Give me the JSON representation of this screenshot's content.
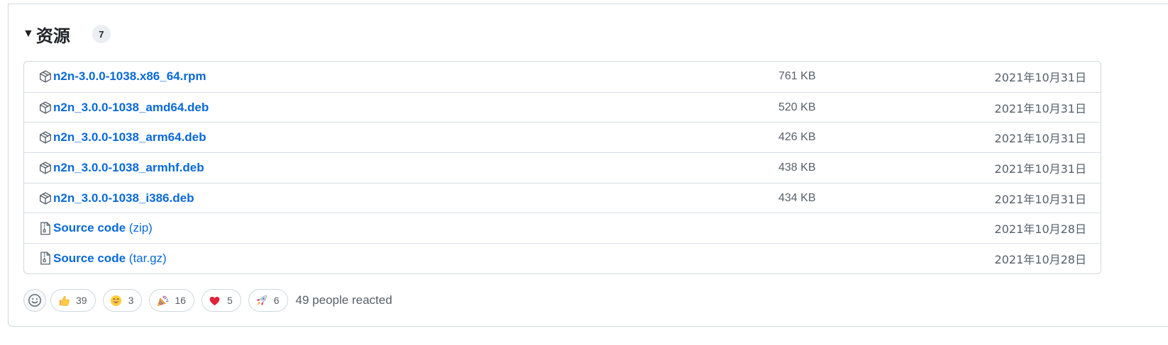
{
  "assets": {
    "title": "资源",
    "count": "7",
    "items": [
      {
        "name": "n2n-3.0.0-1038.x86_64.rpm",
        "suffix": "",
        "size": "761 KB",
        "date": "2021年10月31日",
        "icon": "package-icon"
      },
      {
        "name": "n2n_3.0.0-1038_amd64.deb",
        "suffix": "",
        "size": "520 KB",
        "date": "2021年10月31日",
        "icon": "package-icon"
      },
      {
        "name": "n2n_3.0.0-1038_arm64.deb",
        "suffix": "",
        "size": "426 KB",
        "date": "2021年10月31日",
        "icon": "package-icon"
      },
      {
        "name": "n2n_3.0.0-1038_armhf.deb",
        "suffix": "",
        "size": "438 KB",
        "date": "2021年10月31日",
        "icon": "package-icon"
      },
      {
        "name": "n2n_3.0.0-1038_i386.deb",
        "suffix": "",
        "size": "434 KB",
        "date": "2021年10月31日",
        "icon": "package-icon"
      },
      {
        "name": "Source code",
        "suffix": "(zip)",
        "size": "",
        "date": "2021年10月28日",
        "icon": "file-zip-icon"
      },
      {
        "name": "Source code",
        "suffix": "(tar.gz)",
        "size": "",
        "date": "2021年10月28日",
        "icon": "file-zip-icon"
      }
    ]
  },
  "reactions": {
    "items": [
      {
        "emoji": "thumbs-up-icon",
        "count": "39"
      },
      {
        "emoji": "smile-icon",
        "count": "3"
      },
      {
        "emoji": "tada-icon",
        "count": "16"
      },
      {
        "emoji": "heart-icon",
        "count": "5"
      },
      {
        "emoji": "rocket-icon",
        "count": "6"
      }
    ],
    "summary": "49 people reacted"
  },
  "colors": {
    "link": "#0969da",
    "muted": "#57606a",
    "border": "#d0d7de"
  }
}
